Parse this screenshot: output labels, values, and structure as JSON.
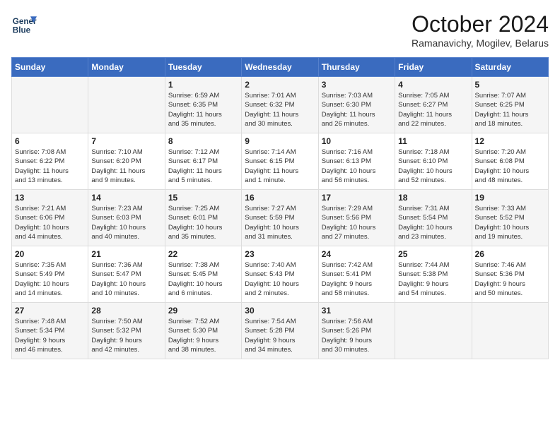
{
  "header": {
    "logo_line1": "General",
    "logo_line2": "Blue",
    "month": "October 2024",
    "location": "Ramanavichy, Mogilev, Belarus"
  },
  "days_of_week": [
    "Sunday",
    "Monday",
    "Tuesday",
    "Wednesday",
    "Thursday",
    "Friday",
    "Saturday"
  ],
  "weeks": [
    [
      {
        "day": "",
        "info": ""
      },
      {
        "day": "",
        "info": ""
      },
      {
        "day": "1",
        "info": "Sunrise: 6:59 AM\nSunset: 6:35 PM\nDaylight: 11 hours\nand 35 minutes."
      },
      {
        "day": "2",
        "info": "Sunrise: 7:01 AM\nSunset: 6:32 PM\nDaylight: 11 hours\nand 30 minutes."
      },
      {
        "day": "3",
        "info": "Sunrise: 7:03 AM\nSunset: 6:30 PM\nDaylight: 11 hours\nand 26 minutes."
      },
      {
        "day": "4",
        "info": "Sunrise: 7:05 AM\nSunset: 6:27 PM\nDaylight: 11 hours\nand 22 minutes."
      },
      {
        "day": "5",
        "info": "Sunrise: 7:07 AM\nSunset: 6:25 PM\nDaylight: 11 hours\nand 18 minutes."
      }
    ],
    [
      {
        "day": "6",
        "info": "Sunrise: 7:08 AM\nSunset: 6:22 PM\nDaylight: 11 hours\nand 13 minutes."
      },
      {
        "day": "7",
        "info": "Sunrise: 7:10 AM\nSunset: 6:20 PM\nDaylight: 11 hours\nand 9 minutes."
      },
      {
        "day": "8",
        "info": "Sunrise: 7:12 AM\nSunset: 6:17 PM\nDaylight: 11 hours\nand 5 minutes."
      },
      {
        "day": "9",
        "info": "Sunrise: 7:14 AM\nSunset: 6:15 PM\nDaylight: 11 hours\nand 1 minute."
      },
      {
        "day": "10",
        "info": "Sunrise: 7:16 AM\nSunset: 6:13 PM\nDaylight: 10 hours\nand 56 minutes."
      },
      {
        "day": "11",
        "info": "Sunrise: 7:18 AM\nSunset: 6:10 PM\nDaylight: 10 hours\nand 52 minutes."
      },
      {
        "day": "12",
        "info": "Sunrise: 7:20 AM\nSunset: 6:08 PM\nDaylight: 10 hours\nand 48 minutes."
      }
    ],
    [
      {
        "day": "13",
        "info": "Sunrise: 7:21 AM\nSunset: 6:06 PM\nDaylight: 10 hours\nand 44 minutes."
      },
      {
        "day": "14",
        "info": "Sunrise: 7:23 AM\nSunset: 6:03 PM\nDaylight: 10 hours\nand 40 minutes."
      },
      {
        "day": "15",
        "info": "Sunrise: 7:25 AM\nSunset: 6:01 PM\nDaylight: 10 hours\nand 35 minutes."
      },
      {
        "day": "16",
        "info": "Sunrise: 7:27 AM\nSunset: 5:59 PM\nDaylight: 10 hours\nand 31 minutes."
      },
      {
        "day": "17",
        "info": "Sunrise: 7:29 AM\nSunset: 5:56 PM\nDaylight: 10 hours\nand 27 minutes."
      },
      {
        "day": "18",
        "info": "Sunrise: 7:31 AM\nSunset: 5:54 PM\nDaylight: 10 hours\nand 23 minutes."
      },
      {
        "day": "19",
        "info": "Sunrise: 7:33 AM\nSunset: 5:52 PM\nDaylight: 10 hours\nand 19 minutes."
      }
    ],
    [
      {
        "day": "20",
        "info": "Sunrise: 7:35 AM\nSunset: 5:49 PM\nDaylight: 10 hours\nand 14 minutes."
      },
      {
        "day": "21",
        "info": "Sunrise: 7:36 AM\nSunset: 5:47 PM\nDaylight: 10 hours\nand 10 minutes."
      },
      {
        "day": "22",
        "info": "Sunrise: 7:38 AM\nSunset: 5:45 PM\nDaylight: 10 hours\nand 6 minutes."
      },
      {
        "day": "23",
        "info": "Sunrise: 7:40 AM\nSunset: 5:43 PM\nDaylight: 10 hours\nand 2 minutes."
      },
      {
        "day": "24",
        "info": "Sunrise: 7:42 AM\nSunset: 5:41 PM\nDaylight: 9 hours\nand 58 minutes."
      },
      {
        "day": "25",
        "info": "Sunrise: 7:44 AM\nSunset: 5:38 PM\nDaylight: 9 hours\nand 54 minutes."
      },
      {
        "day": "26",
        "info": "Sunrise: 7:46 AM\nSunset: 5:36 PM\nDaylight: 9 hours\nand 50 minutes."
      }
    ],
    [
      {
        "day": "27",
        "info": "Sunrise: 7:48 AM\nSunset: 5:34 PM\nDaylight: 9 hours\nand 46 minutes."
      },
      {
        "day": "28",
        "info": "Sunrise: 7:50 AM\nSunset: 5:32 PM\nDaylight: 9 hours\nand 42 minutes."
      },
      {
        "day": "29",
        "info": "Sunrise: 7:52 AM\nSunset: 5:30 PM\nDaylight: 9 hours\nand 38 minutes."
      },
      {
        "day": "30",
        "info": "Sunrise: 7:54 AM\nSunset: 5:28 PM\nDaylight: 9 hours\nand 34 minutes."
      },
      {
        "day": "31",
        "info": "Sunrise: 7:56 AM\nSunset: 5:26 PM\nDaylight: 9 hours\nand 30 minutes."
      },
      {
        "day": "",
        "info": ""
      },
      {
        "day": "",
        "info": ""
      }
    ]
  ]
}
